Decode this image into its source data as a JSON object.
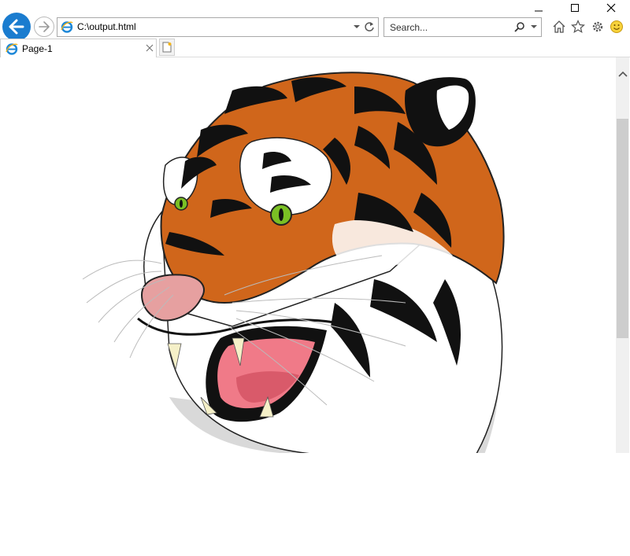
{
  "window": {
    "controls": [
      "minimize",
      "maximize",
      "close"
    ]
  },
  "navbar": {
    "address_url": "C:\\output.html",
    "search_placeholder": "Search..."
  },
  "tabs": [
    {
      "title": "Page-1"
    }
  ],
  "page": {
    "image_name": "tiger-illustration",
    "scroll_position_fraction": 0.0
  },
  "colors": {
    "accent": "#1a7ccf",
    "tiger_orange": "#d0661b",
    "eye_green": "#7ac024"
  }
}
